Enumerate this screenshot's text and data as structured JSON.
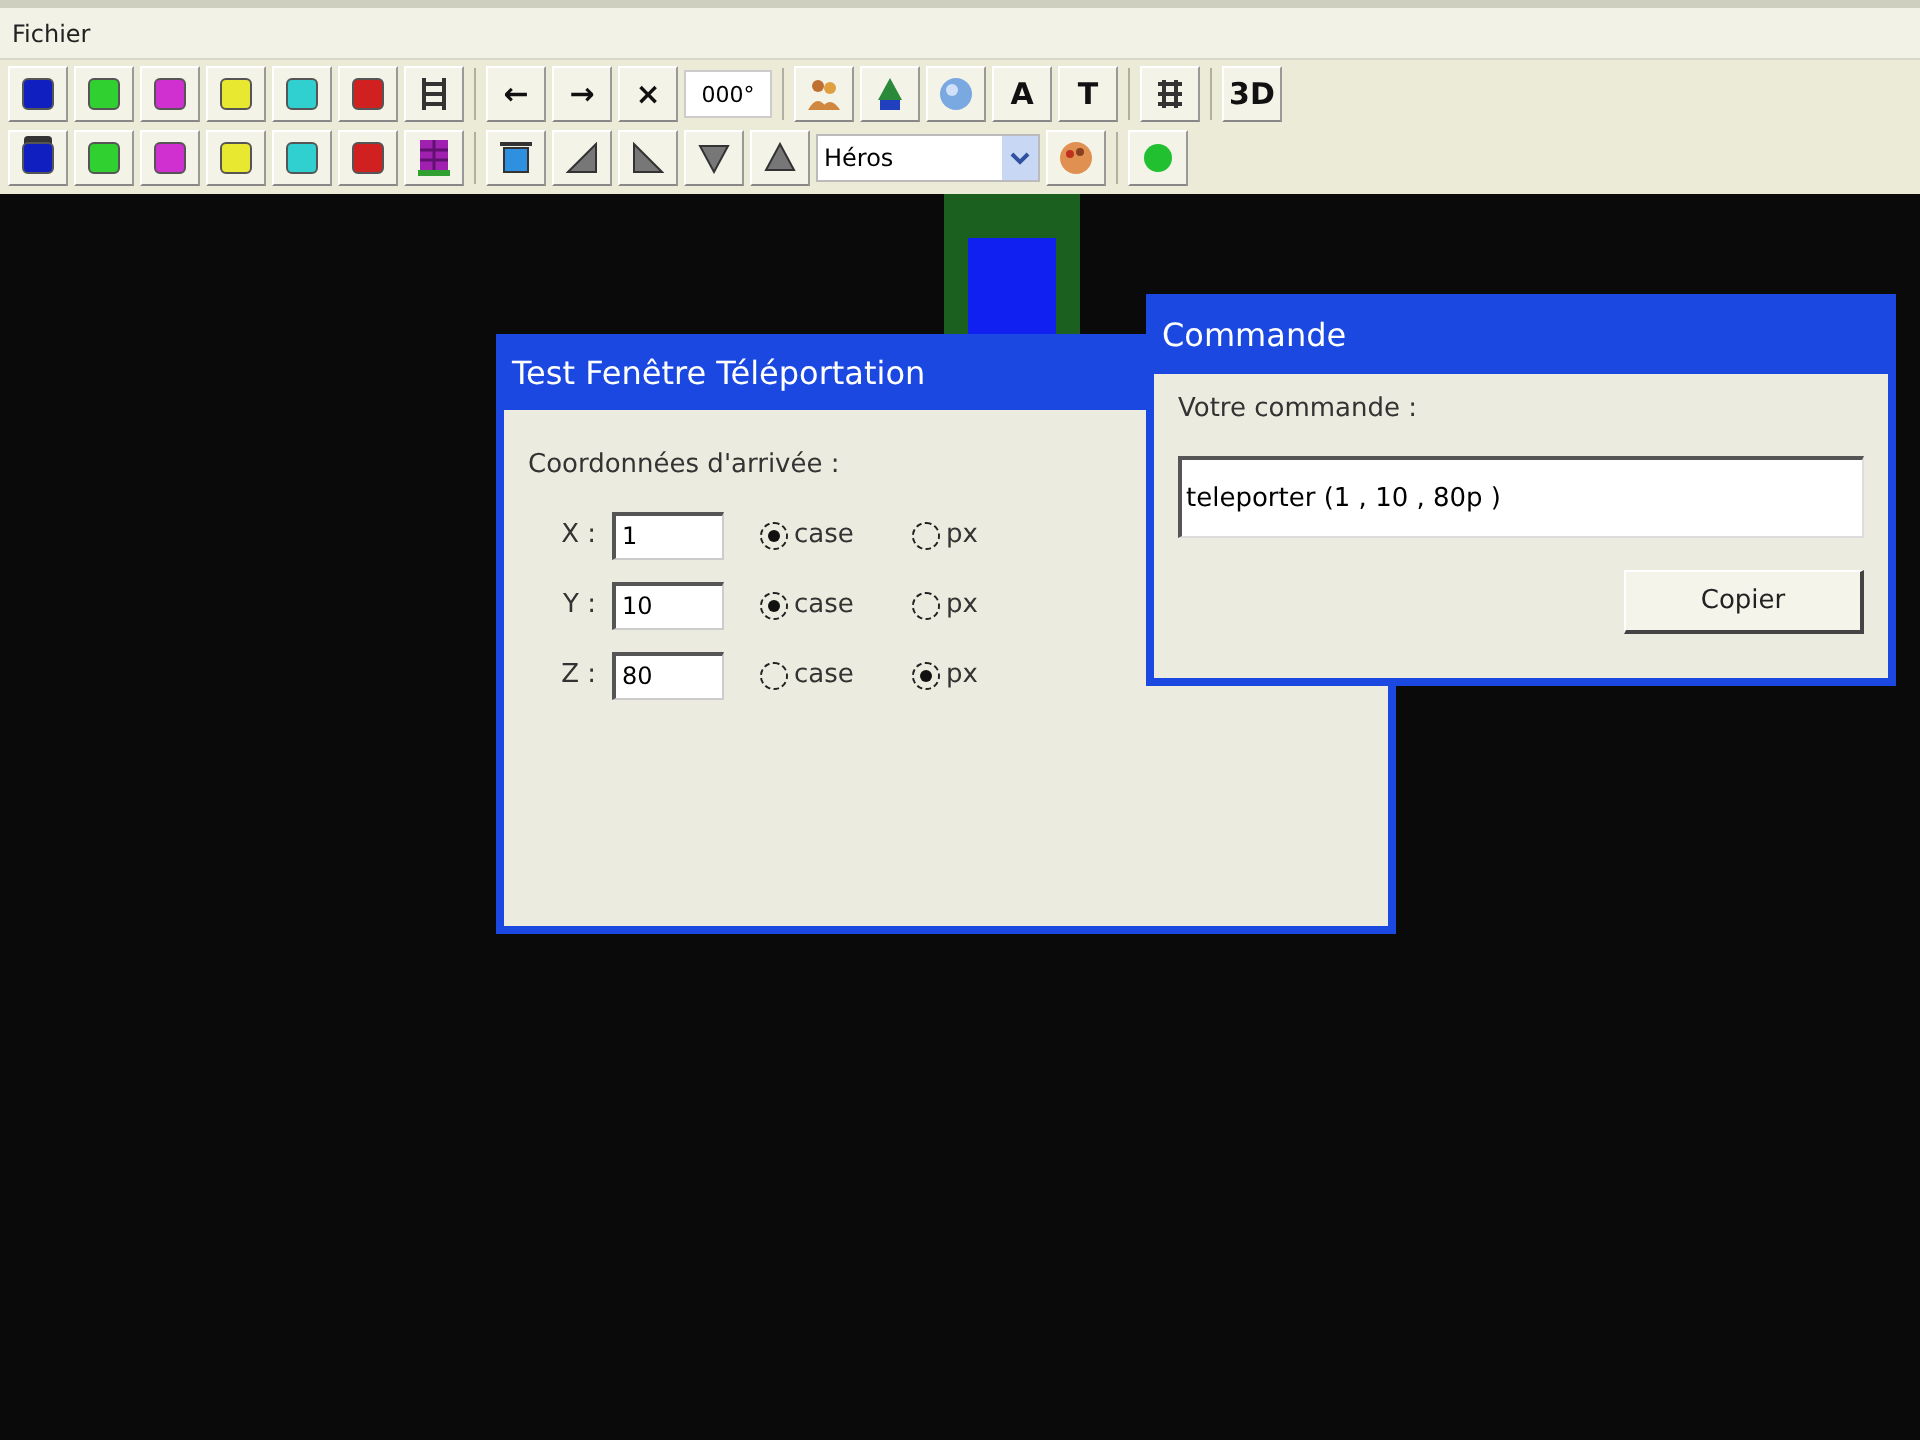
{
  "menu": [
    {
      "label": "Fichier"
    }
  ],
  "toolbar_rows": [
    [
      {
        "kind": "swatch",
        "color": "#1020c0"
      },
      {
        "kind": "swatch",
        "color": "#30d030"
      },
      {
        "kind": "swatch",
        "color": "#d030d0"
      },
      {
        "kind": "swatch",
        "color": "#e8e830"
      },
      {
        "kind": "swatch",
        "color": "#30d0d0"
      },
      {
        "kind": "swatch",
        "color": "#d02020"
      },
      {
        "kind": "ladder"
      },
      {
        "kind": "separator"
      },
      {
        "kind": "glyph",
        "text": "←"
      },
      {
        "kind": "glyph",
        "text": "→"
      },
      {
        "kind": "glyph",
        "text": "×"
      },
      {
        "kind": "field",
        "value": "000°"
      },
      {
        "kind": "separator"
      },
      {
        "kind": "people"
      },
      {
        "kind": "tree"
      },
      {
        "kind": "sphere"
      },
      {
        "kind": "glyph",
        "text": "A"
      },
      {
        "kind": "glyph",
        "text": "T"
      },
      {
        "kind": "separator"
      },
      {
        "kind": "grid"
      },
      {
        "kind": "separator"
      },
      {
        "kind": "glyph",
        "text": "3D"
      }
    ],
    [
      {
        "kind": "swatch",
        "color": "#1020c0",
        "framed": true
      },
      {
        "kind": "swatch",
        "color": "#30d030",
        "framed": false
      },
      {
        "kind": "swatch",
        "color": "#d030d0",
        "framed": false
      },
      {
        "kind": "swatch",
        "color": "#e8e830",
        "framed": false
      },
      {
        "kind": "swatch",
        "color": "#30d0d0",
        "framed": false
      },
      {
        "kind": "swatch",
        "color": "#d02020",
        "framed": false
      },
      {
        "kind": "block"
      },
      {
        "kind": "separator"
      },
      {
        "kind": "square"
      },
      {
        "kind": "wedgeright"
      },
      {
        "kind": "wedgeleft"
      },
      {
        "kind": "triangledown"
      },
      {
        "kind": "triangleup"
      },
      {
        "kind": "dropdown",
        "value": "Héros"
      },
      {
        "kind": "palette"
      },
      {
        "kind": "separator"
      },
      {
        "kind": "dot"
      }
    ]
  ],
  "teleport_window": {
    "title": "Test Fenêtre Téléportation",
    "section_label": "Coordonnées d'arrivée :",
    "rows": [
      {
        "axis": "X :",
        "value": "1",
        "options": [
          {
            "label": "case",
            "selected": true
          },
          {
            "label": "px",
            "selected": false
          }
        ]
      },
      {
        "axis": "Y :",
        "value": "10",
        "options": [
          {
            "label": "case",
            "selected": true
          },
          {
            "label": "px",
            "selected": false
          }
        ]
      },
      {
        "axis": "Z :",
        "value": "80",
        "options": [
          {
            "label": "case",
            "selected": false
          },
          {
            "label": "px",
            "selected": true
          }
        ]
      }
    ]
  },
  "command_window": {
    "title": "Commande",
    "label": "Votre commande :",
    "value": "teleporter (1 , 10 , 80p )",
    "button": "Copier"
  }
}
